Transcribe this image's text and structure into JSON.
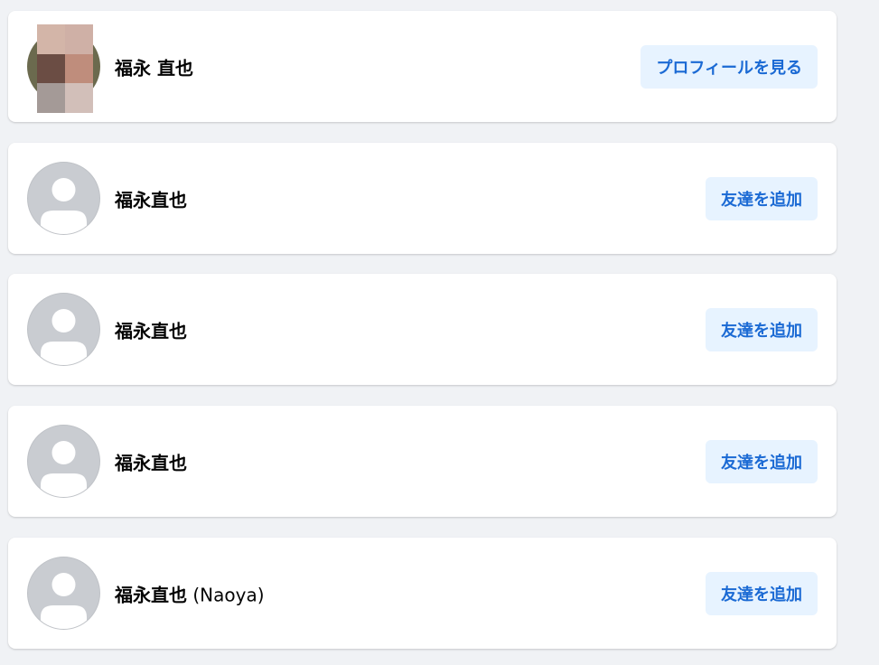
{
  "results": [
    {
      "name": "福永 直也",
      "name_suffix": "",
      "action_label": "プロフィールを見る",
      "avatar_type": "photo-mosaic",
      "mosaic_colors": [
        "#d3b5a8",
        "#cfb0a6",
        "#6b4d44",
        "#bf8d7c",
        "#a49a97",
        "#d2bfb9"
      ]
    },
    {
      "name": "福永直也",
      "name_suffix": "",
      "action_label": "友達を追加",
      "avatar_type": "default-silhouette"
    },
    {
      "name": "福永直也",
      "name_suffix": "",
      "action_label": "友達を追加",
      "avatar_type": "default-silhouette"
    },
    {
      "name": "福永直也",
      "name_suffix": "",
      "action_label": "友達を追加",
      "avatar_type": "default-silhouette"
    },
    {
      "name": "福永直也",
      "name_suffix": " (Naoya)",
      "action_label": "友達を追加",
      "avatar_type": "default-silhouette"
    }
  ],
  "colors": {
    "page_background": "#f0f2f5",
    "card_background": "#ffffff",
    "button_background": "#e7f3ff",
    "button_text": "#1b6ad4",
    "avatar_placeholder": "#c9ccd1"
  }
}
